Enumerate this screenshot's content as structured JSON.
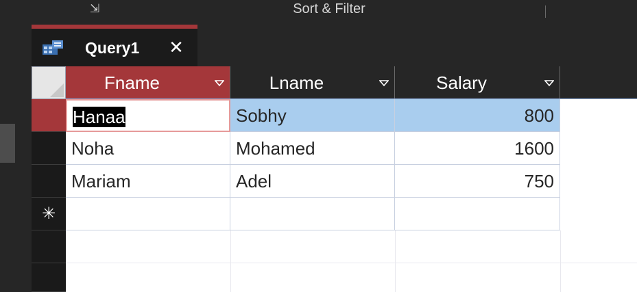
{
  "ribbon": {
    "launcher_glyph": "⇲",
    "group_label": "Sort & Filter"
  },
  "tab": {
    "title": "Query1",
    "close_glyph": "✕",
    "icon": "query-icon"
  },
  "datasheet": {
    "columns": [
      {
        "name": "Fname"
      },
      {
        "name": "Lname"
      },
      {
        "name": "Salary"
      }
    ],
    "rows": [
      {
        "Fname": "Hanaa",
        "Lname": "Sobhy",
        "Salary": "800"
      },
      {
        "Fname": "Noha",
        "Lname": "Mohamed",
        "Salary": "1600"
      },
      {
        "Fname": "Mariam",
        "Lname": "Adel",
        "Salary": "750"
      }
    ],
    "new_record_glyph": "✳"
  },
  "colors": {
    "accent": "#a4373a",
    "selected_row": "#a9cdee",
    "frame": "#262626"
  }
}
